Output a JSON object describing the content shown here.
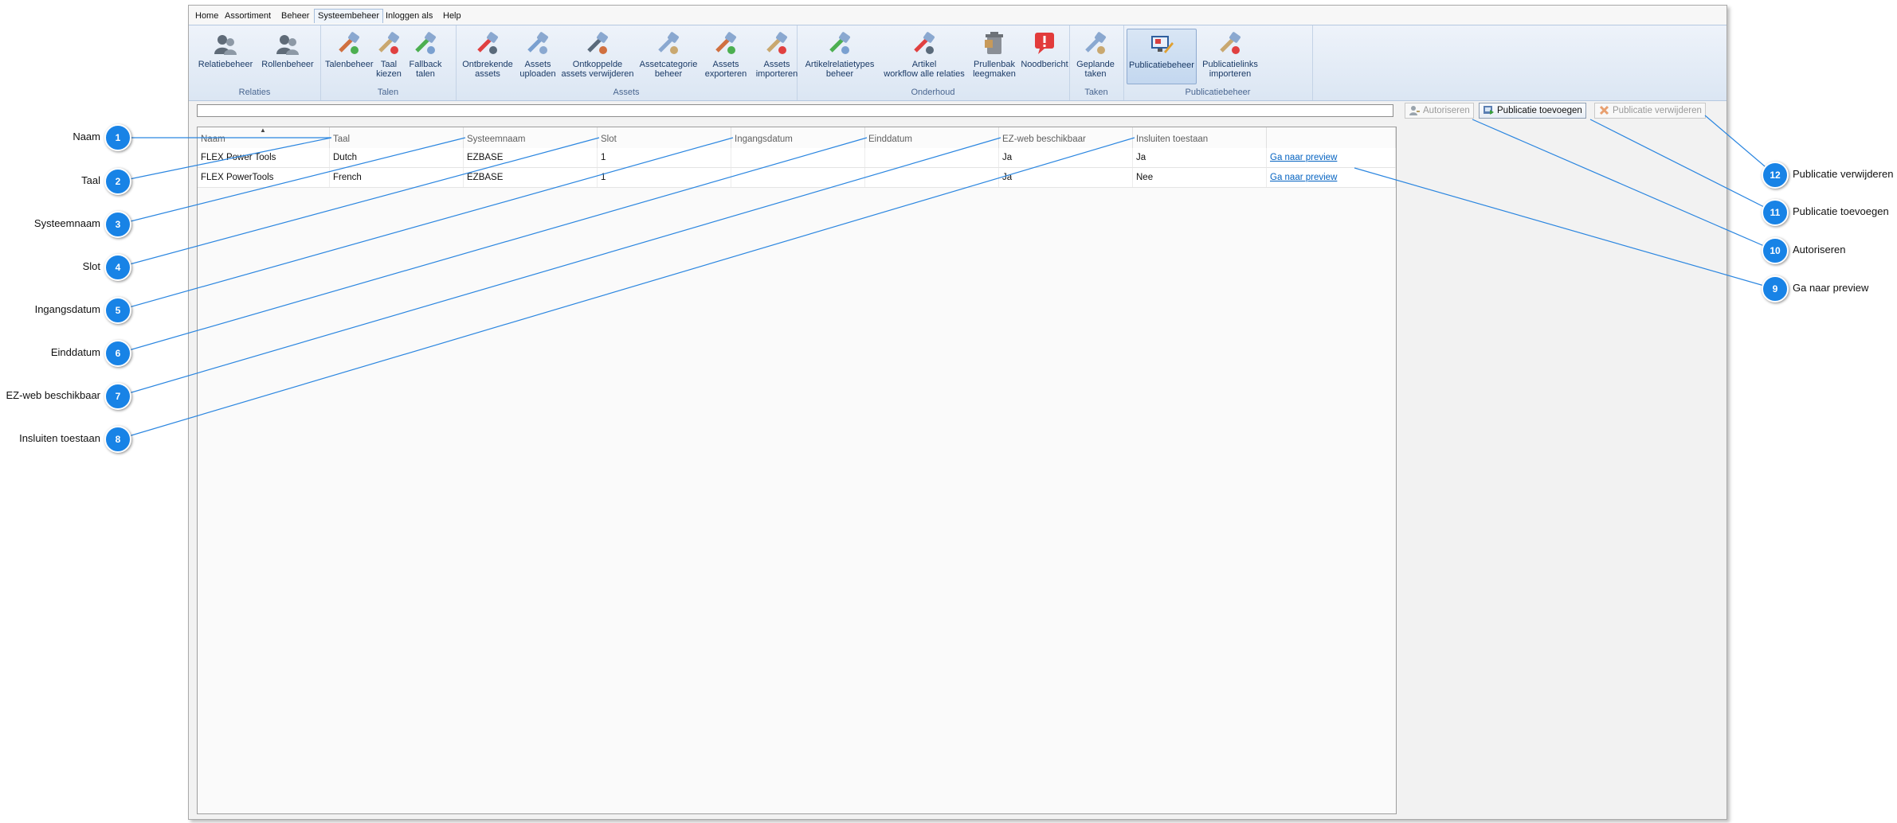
{
  "menu": [
    "Home",
    "Assortiment",
    "Beheer",
    "Systeembeheer",
    "Inloggen als",
    "Help"
  ],
  "menu_active": "Systeembeheer",
  "ribbon": {
    "groups": [
      {
        "label": "Relaties",
        "buttons": [
          {
            "label": "Relatiebeheer",
            "icon": "relations-icon"
          },
          {
            "label": "Rollenbeheer",
            "icon": "roles-icon"
          }
        ]
      },
      {
        "label": "Talen",
        "buttons": [
          {
            "label": "Talenbeheer",
            "icon": "languages-icon"
          },
          {
            "label": "Taal\nkiezen",
            "icon": "choose-language-icon"
          },
          {
            "label": "Fallback\ntalen",
            "icon": "fallback-languages-icon"
          }
        ]
      },
      {
        "label": "Assets",
        "buttons": [
          {
            "label": "Ontbrekende\nassets",
            "icon": "missing-assets-icon"
          },
          {
            "label": "Assets\nuploaden",
            "icon": "upload-assets-icon"
          },
          {
            "label": "Ontkoppelde\nassets verwijderen",
            "icon": "delete-unlinked-assets-icon"
          },
          {
            "label": "Assetcategorie\nbeheer",
            "icon": "asset-category-icon"
          },
          {
            "label": "Assets\nexporteren",
            "icon": "export-assets-icon"
          },
          {
            "label": "Assets\nimporteren",
            "icon": "import-assets-icon"
          }
        ]
      },
      {
        "label": "Onderhoud",
        "buttons": [
          {
            "label": "Artikelrelatietypes\nbeheer",
            "icon": "article-relation-types-icon"
          },
          {
            "label": "Artikel\nworkflow alle relaties",
            "icon": "article-workflow-icon"
          },
          {
            "label": "Prullenbak\nleegmaken",
            "icon": "empty-trash-icon"
          },
          {
            "label": "Noodbericht",
            "icon": "emergency-message-icon"
          }
        ]
      },
      {
        "label": "Taken",
        "buttons": [
          {
            "label": "Geplande\ntaken",
            "icon": "scheduled-tasks-icon"
          }
        ]
      },
      {
        "label": "Publicatiebeheer",
        "buttons": [
          {
            "label": "Publicatiebeheer",
            "icon": "publication-management-icon"
          },
          {
            "label": "Publicatielinks\nimporteren",
            "icon": "import-publication-links-icon"
          }
        ]
      }
    ],
    "selected_button": "Publicatiebeheer"
  },
  "toolbar": {
    "autoriseren": "Autoriseren",
    "publicatie_toevoegen": "Publicatie toevoegen",
    "publicatie_verwijderen": "Publicatie verwijderen"
  },
  "grid": {
    "columns": [
      "Naam",
      "Taal",
      "Systeemnaam",
      "Slot",
      "Ingangsdatum",
      "Einddatum",
      "EZ-web beschikbaar",
      "Insluiten toestaan",
      ""
    ],
    "rows": [
      [
        "FLEX Power Tools",
        "Dutch",
        "EZBASE",
        "1",
        "",
        "",
        "Ja",
        "Ja",
        "Ga naar preview"
      ],
      [
        "FLEX PowerTools",
        "French",
        "EZBASE",
        "1",
        "",
        "",
        "Ja",
        "Nee",
        "Ga naar preview"
      ]
    ]
  },
  "callouts": [
    {
      "n": "1",
      "label": "Naam"
    },
    {
      "n": "2",
      "label": "Taal"
    },
    {
      "n": "3",
      "label": "Systeemnaam"
    },
    {
      "n": "4",
      "label": "Slot"
    },
    {
      "n": "5",
      "label": "Ingangsdatum"
    },
    {
      "n": "6",
      "label": "Einddatum"
    },
    {
      "n": "7",
      "label": "EZ-web beschikbaar"
    },
    {
      "n": "8",
      "label": "Insluiten toestaan"
    },
    {
      "n": "9",
      "label": "Ga naar preview"
    },
    {
      "n": "10",
      "label": "Autoriseren"
    },
    {
      "n": "11",
      "label": "Publicatie toevoegen"
    },
    {
      "n": "12",
      "label": "Publicatie verwijderen"
    }
  ],
  "colors": {
    "badge": "#1883e6",
    "line": "#2b86e0",
    "link": "#0563c1"
  }
}
